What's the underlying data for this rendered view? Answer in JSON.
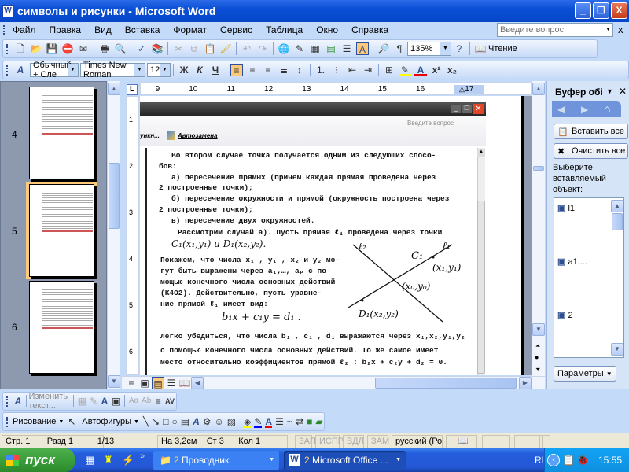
{
  "window": {
    "title": "символы и рисунки - Microsoft Word",
    "word_icon": "W",
    "min": "_",
    "max": "❐",
    "close": "X"
  },
  "menu": {
    "items": [
      "Файл",
      "Правка",
      "Вид",
      "Вставка",
      "Формат",
      "Сервис",
      "Таблица",
      "Окно",
      "Справка"
    ],
    "ask_placeholder": "Введите вопрос",
    "close": "x"
  },
  "standard_toolbar": {
    "zoom": "135%",
    "reading": "Чтение"
  },
  "formatting_toolbar": {
    "style": "Обычный + Сле",
    "font": "Times New Roman",
    "size": "12",
    "bold": "Ж",
    "italic": "К",
    "underline": "Ч",
    "font_color_letter": "A",
    "superscript": "x²",
    "subscript": "x₂"
  },
  "thumbnails": [
    {
      "num": "4"
    },
    {
      "num": "5"
    },
    {
      "num": "6"
    }
  ],
  "ruler": {
    "tab": "L",
    "ticks": [
      "9",
      "10",
      "11",
      "12",
      "13",
      "14",
      "15",
      "16",
      "17"
    ],
    "vticks": [
      "1",
      "2",
      "3",
      "4",
      "5",
      "6"
    ]
  },
  "scan": {
    "ask": "Введите вопрос",
    "toolbar_partial": "ункн...",
    "autocorrect": "Автозамена",
    "lines": [
      "Во втором случае точка получается одним из следующих спосо-",
      "бов:",
      "а) пересечение прямых (причем каждая прямая проведена через",
      "2  построенные точки);",
      "б) пересечение окружности и прямой (окружность построена через",
      "2  построенные точки);",
      "в) пересечение двух окружностей.",
      "Рассмотрим случай а). Пусть прямая ℓ₁  проведена через точки",
      "C₁(x₁,y₁) и D₁(x₂,y₂).",
      "Покажем, что числа x₁ , y₁ , x₂ и y₂ мо-",
      "гут быть выражены через a₁,…, aₚ с по-",
      "мощью конечного числа основных действий",
      "(К4О2). Действительно, пусть уравне-",
      "ние прямой ℓ₁ имеет вид:",
      "b₁x + c₁y = d₁ .",
      "Легко убедиться, что числа b₁ , c₁ , d₁  выражаются через x₁,x₂,y₁,y₂",
      "с помощью конечного числа основных действий. То же самое имеет",
      "место относительно  коэффициентов прямой ℓ₂ : b₂x + c₂y + d₂ = 0."
    ],
    "diagram": {
      "l1": "ℓ₁",
      "l2": "ℓ₂",
      "c1": "C₁",
      "c1_coords": "(x₁,y₁)",
      "x0": "(x₀,y₀)",
      "d1": "D₁(x₂,y₂)"
    }
  },
  "task_pane": {
    "title": "Буфер обі",
    "paste_all": "Вставить все",
    "clear_all": "Очистить все",
    "prompt": "Выберите вставляемый объект:",
    "items": [
      "l1",
      "a1,...",
      "2"
    ],
    "options": "Параметры"
  },
  "wordart_toolbar": {
    "edit_text": "Изменить текст..."
  },
  "drawing_toolbar": {
    "draw": "Рисование",
    "autoshapes": "Автофигуры"
  },
  "status": {
    "page": "Стр. 1",
    "section": "Разд  1",
    "pages": "1/13",
    "at": "На 3,2см",
    "line": "Ст 3",
    "col": "Кол 1",
    "rec": "ЗАП",
    "trk": "ИСПР",
    "ext": "ВДЛ",
    "ovr": "ЗАМ",
    "lang": "русский (Ро"
  },
  "taskbar": {
    "start": "пуск",
    "tasks": [
      {
        "count": "2",
        "label": "Проводник"
      },
      {
        "count": "2",
        "label": "Microsoft Office ..."
      }
    ],
    "lang": "RL",
    "time": "15:55"
  }
}
